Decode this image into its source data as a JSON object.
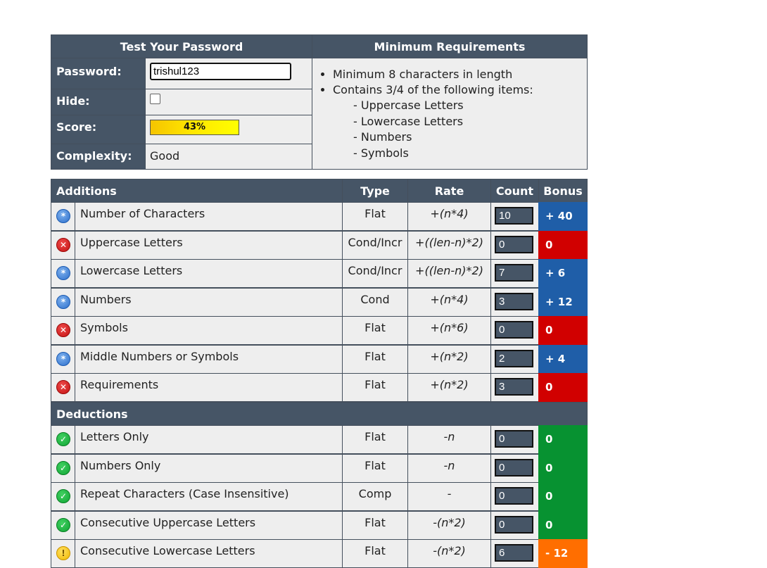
{
  "top": {
    "test_header": "Test Your Password",
    "min_header": "Minimum Requirements",
    "password_label": "Password:",
    "password_value": "trishul123",
    "hide_label": "Hide:",
    "score_label": "Score:",
    "score_value": "43%",
    "score_fraction": 0.43,
    "complexity_label": "Complexity:",
    "complexity_value": "Good",
    "requirements": [
      "Minimum 8 characters in length",
      "Contains 3/4 of the following items:"
    ],
    "sub_items": [
      "- Uppercase Letters",
      "- Lowercase Letters",
      "- Numbers",
      "- Symbols"
    ]
  },
  "table": {
    "headers": {
      "additions": "Additions",
      "type": "Type",
      "rate": "Rate",
      "count": "Count",
      "bonus": "Bonus"
    },
    "deductions_header": "Deductions",
    "additions": [
      {
        "icon": "info-icon",
        "label": "Number of Characters",
        "type": "Flat",
        "rate": "+(n*4)",
        "count": "10",
        "bonus": "+ 40",
        "bonus_color": "#1f5ea8"
      },
      {
        "icon": "error-icon",
        "label": "Uppercase Letters",
        "type": "Cond/Incr",
        "rate": "+((len-n)*2)",
        "count": "0",
        "bonus": "0",
        "bonus_color": "#d10000"
      },
      {
        "icon": "info-icon",
        "label": "Lowercase Letters",
        "type": "Cond/Incr",
        "rate": "+((len-n)*2)",
        "count": "7",
        "bonus": "+ 6",
        "bonus_color": "#1f5ea8"
      },
      {
        "icon": "info-icon",
        "label": "Numbers",
        "type": "Cond",
        "rate": "+(n*4)",
        "count": "3",
        "bonus": "+ 12",
        "bonus_color": "#1f5ea8"
      },
      {
        "icon": "error-icon",
        "label": "Symbols",
        "type": "Flat",
        "rate": "+(n*6)",
        "count": "0",
        "bonus": "0",
        "bonus_color": "#d10000"
      },
      {
        "icon": "info-icon",
        "label": "Middle Numbers or Symbols",
        "type": "Flat",
        "rate": "+(n*2)",
        "count": "2",
        "bonus": "+ 4",
        "bonus_color": "#1f5ea8"
      },
      {
        "icon": "error-icon",
        "label": "Requirements",
        "type": "Flat",
        "rate": "+(n*2)",
        "count": "3",
        "bonus": "0",
        "bonus_color": "#d10000"
      }
    ],
    "deductions": [
      {
        "icon": "check-icon",
        "label": "Letters Only",
        "type": "Flat",
        "rate": "-n",
        "count": "0",
        "bonus": "0",
        "bonus_color": "#079231"
      },
      {
        "icon": "check-icon",
        "label": "Numbers Only",
        "type": "Flat",
        "rate": "-n",
        "count": "0",
        "bonus": "0",
        "bonus_color": "#079231"
      },
      {
        "icon": "check-icon",
        "label": "Repeat Characters (Case Insensitive)",
        "type": "Comp",
        "rate": "-",
        "count": "0",
        "bonus": "0",
        "bonus_color": "#079231"
      },
      {
        "icon": "check-icon",
        "label": "Consecutive Uppercase Letters",
        "type": "Flat",
        "rate": "-(n*2)",
        "count": "0",
        "bonus": "0",
        "bonus_color": "#079231"
      },
      {
        "icon": "warning-icon",
        "label": "Consecutive Lowercase Letters",
        "type": "Flat",
        "rate": "-(n*2)",
        "count": "6",
        "bonus": "- 12",
        "bonus_color": "#ff6e00"
      }
    ]
  }
}
